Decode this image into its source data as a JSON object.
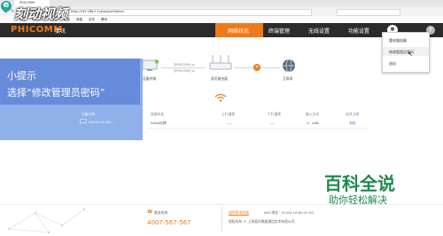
{
  "browser": {
    "tab_title": "PHICOMM",
    "address": "http://192.168.2.1/#/qsj/setStatus",
    "bookmarks": [
      "百度",
      "hao123",
      "新浪",
      "网易",
      "淘宝",
      "京东",
      "腾讯"
    ]
  },
  "header": {
    "logo_text": "PHICOMM",
    "logo_sub": "斐讯",
    "nav": [
      "网络状态",
      "终端管理",
      "无线设置",
      "功能设置"
    ],
    "active_nav": "网络状态",
    "colors": {
      "header": "#2b2b2b",
      "accent": "#f07a18"
    }
  },
  "dropdown": {
    "items": [
      "重启路由器",
      "修改管理员密码",
      "退出"
    ]
  },
  "topology": {
    "device_label": "设备终端",
    "router_label": "斐讯路由器",
    "internet_label": "互联网",
    "device_line1": "@PHICOMM_xx",
    "device_line2": "@PHICOMM_xx",
    "status_icon": "error-x-icon"
  },
  "tip": {
    "title": "小提示",
    "body": "选择“修改管理员密码”"
  },
  "status_panel": {
    "device_name_label": "设备名称",
    "device_name_value": "SHIMSUR-MKL..."
  },
  "table": {
    "headers": [
      "连接时长",
      "上行速率",
      "下行速率",
      "接入方式",
      "允许上网"
    ],
    "row": [
      "2Gb4分钟",
      "----",
      "----",
      "LAN",
      "本机"
    ]
  },
  "footer": {
    "hotline_label": "服务热线",
    "hotline_number": "4007-567-567",
    "firmware_label": "固件版本检测",
    "mac_label": "MAC地址：2C:B2:1A:60:2C:6C",
    "copyright": "版权所有 © 上海斐讯数据通信技术有限公司"
  },
  "watermark": {
    "logo": "刻动视频",
    "brand": "百科全说",
    "slogan": "助你轻松解决"
  }
}
